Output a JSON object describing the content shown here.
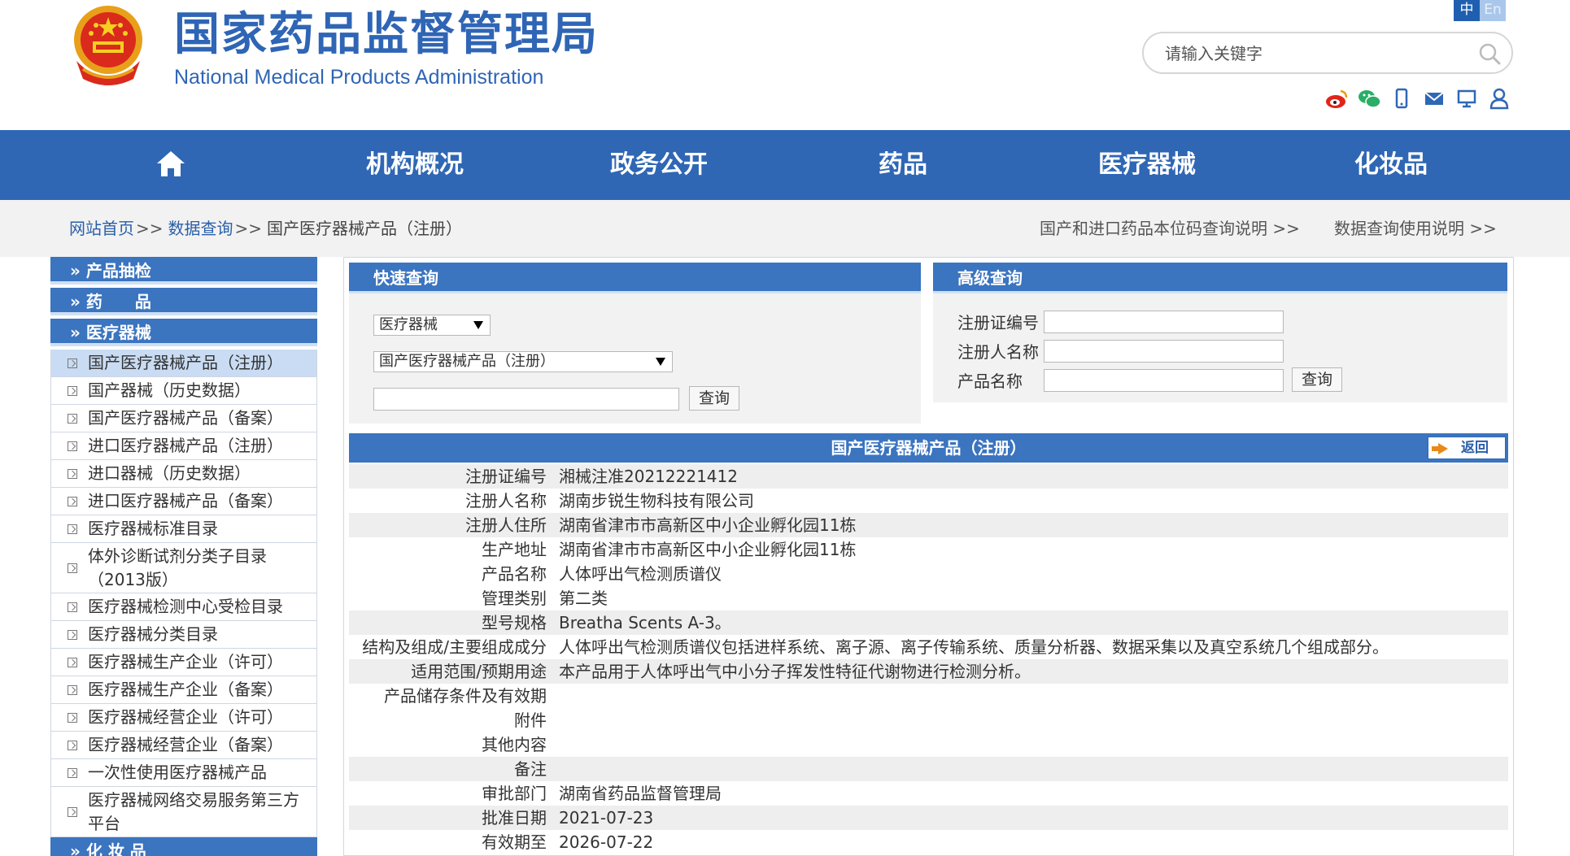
{
  "header": {
    "title_cn": "国家药品监督管理局",
    "title_en": "National Medical Products Administration",
    "lang_zh": "中",
    "lang_en": "En",
    "search_placeholder": "请输入关键字",
    "social_icons": [
      "weibo-icon",
      "wechat-icon",
      "mobile-icon",
      "mail-icon",
      "monitor-icon",
      "user-icon"
    ]
  },
  "nav": {
    "items": [
      "机构概况",
      "政务公开",
      "药品",
      "医疗器械",
      "化妆品"
    ]
  },
  "breadcrumb": {
    "home": "网站首页",
    "data": "数据查询",
    "current": "国产医疗器械产品（注册）",
    "sep": ">>",
    "right1": "国产和进口药品本位码查询说明 >>",
    "right2": "数据查询使用说明 >>"
  },
  "sidebar": {
    "heads": [
      "» 产品抽检",
      "» 药　　品",
      "» 医疗器械"
    ],
    "items": [
      "国产医疗器械产品（注册）",
      "国产器械（历史数据）",
      "国产医疗器械产品（备案）",
      "进口医疗器械产品（注册）",
      "进口器械（历史数据）",
      "进口医疗器械产品（备案）",
      "医疗器械标准目录",
      "体外诊断试剂分类子目录（2013版）",
      "医疗器械检测中心受检目录",
      "医疗器械分类目录",
      "医疗器械生产企业（许可）",
      "医疗器械生产企业（备案）",
      "医疗器械经营企业（许可）",
      "医疗器械经营企业（备案）",
      "一次性使用医疗器械产品",
      "医疗器械网络交易服务第三方平台"
    ],
    "bottom_head": "» 化 妆 品"
  },
  "quick": {
    "title": "快速查询",
    "select1": "医疗器械",
    "select2": "国产医疗器械产品（注册）",
    "button": "查询"
  },
  "advanced": {
    "title": "高级查询",
    "label1": "注册证编号",
    "label2": "注册人名称",
    "label3": "产品名称",
    "button": "查询"
  },
  "detail": {
    "title": "国产医疗器械产品（注册）",
    "back": "返回",
    "rows": [
      {
        "k": "注册证编号",
        "v": "湘械注准20212221412"
      },
      {
        "k": "注册人名称",
        "v": "湖南步锐生物科技有限公司"
      },
      {
        "k": "注册人住所",
        "v": "湖南省津市市高新区中小企业孵化园11栋"
      },
      {
        "k": "生产地址",
        "v": "湖南省津市市高新区中小企业孵化园11栋"
      },
      {
        "k": "产品名称",
        "v": "人体呼出气检测质谱仪"
      },
      {
        "k": "管理类别",
        "v": "第二类"
      },
      {
        "k": "型号规格",
        "v": "Breatha Scents A-3。"
      },
      {
        "k": "结构及组成/主要组成成分",
        "v": "人体呼出气检测质谱仪包括进样系统、离子源、离子传输系统、质量分析器、数据采集以及真空系统几个组成部分。"
      },
      {
        "k": "适用范围/预期用途",
        "v": "本产品用于人体呼出气中小分子挥发性特征代谢物进行检测分析。"
      },
      {
        "k": "产品储存条件及有效期",
        "v": ""
      },
      {
        "k": "附件",
        "v": ""
      },
      {
        "k": "其他内容",
        "v": ""
      },
      {
        "k": "备注",
        "v": ""
      },
      {
        "k": "审批部门",
        "v": "湖南省药品监督管理局"
      },
      {
        "k": "批准日期",
        "v": "2021-07-23"
      },
      {
        "k": "有效期至",
        "v": "2026-07-22"
      }
    ]
  }
}
